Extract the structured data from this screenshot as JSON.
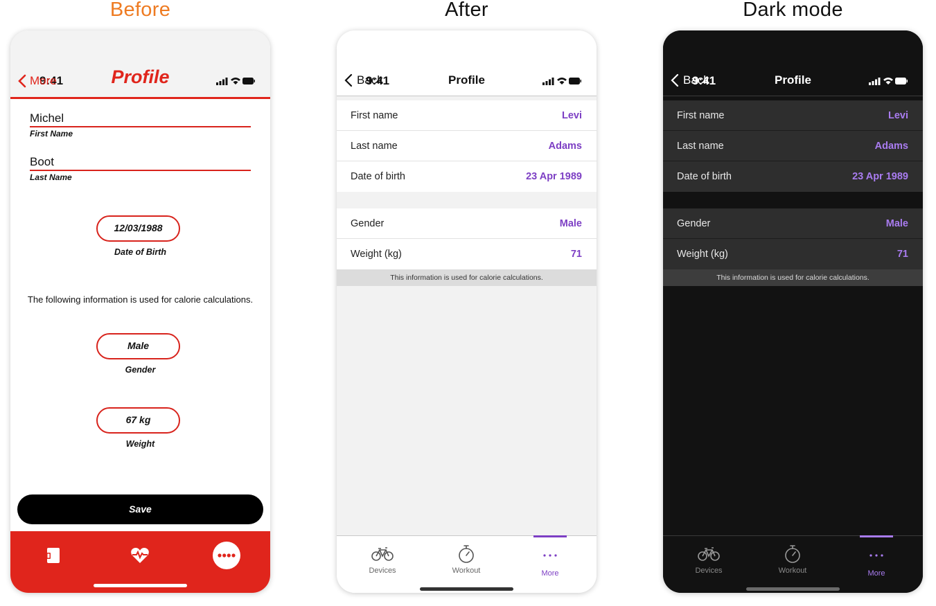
{
  "headings": {
    "before": "Before",
    "after": "After",
    "dark": "Dark mode"
  },
  "colors": {
    "before_accent": "#e0251c",
    "heading_orange": "#ee7b22",
    "purple": "#7d3fc4",
    "purple_dark": "#a97cf0"
  },
  "before": {
    "status_time": "9:41",
    "nav": {
      "back_label": "More",
      "title": "Profile"
    },
    "first_name": {
      "value": "Michel",
      "caption": "First Name"
    },
    "last_name": {
      "value": "Boot",
      "caption": "Last Name"
    },
    "dob": {
      "value": "12/03/1988",
      "caption": "Date of Birth"
    },
    "info_text": "The following information is used for calorie calculations.",
    "gender": {
      "value": "Male",
      "caption": "Gender"
    },
    "weight": {
      "value": "67 kg",
      "caption": "Weight"
    },
    "save_label": "Save",
    "tab_icons": [
      "device-icon",
      "heart-rate-icon",
      "more-icon"
    ]
  },
  "after": {
    "status_time": "9:41",
    "nav": {
      "back_label": "Back",
      "title": "Profile"
    },
    "rows": [
      {
        "label": "First name",
        "value": "Levi"
      },
      {
        "label": "Last name",
        "value": "Adams"
      },
      {
        "label": "Date of birth",
        "value": "23 Apr 1989"
      },
      {
        "label": "Gender",
        "value": "Male"
      },
      {
        "label": "Weight (kg)",
        "value": "71"
      }
    ],
    "footer_note": "This information is used for calorie calculations.",
    "tabs": [
      {
        "label": "Devices",
        "icon": "bicycle-icon"
      },
      {
        "label": "Workout",
        "icon": "stopwatch-icon"
      },
      {
        "label": "More",
        "icon": "more-dots-icon",
        "selected": true
      }
    ]
  },
  "dark": {
    "status_time": "9:41",
    "nav": {
      "back_label": "Back",
      "title": "Profile"
    },
    "rows": [
      {
        "label": "First name",
        "value": "Levi"
      },
      {
        "label": "Last name",
        "value": "Adams"
      },
      {
        "label": "Date of birth",
        "value": "23 Apr 1989"
      },
      {
        "label": "Gender",
        "value": "Male"
      },
      {
        "label": "Weight (kg)",
        "value": "71"
      }
    ],
    "footer_note": "This information is used for calorie calculations.",
    "tabs": [
      {
        "label": "Devices",
        "icon": "bicycle-icon"
      },
      {
        "label": "Workout",
        "icon": "stopwatch-icon"
      },
      {
        "label": "More",
        "icon": "more-dots-icon",
        "selected": true
      }
    ]
  }
}
